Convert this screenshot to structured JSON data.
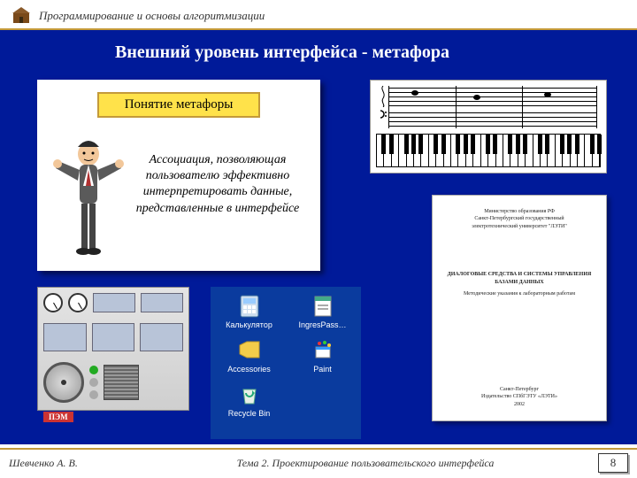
{
  "header": {
    "course": "Программирование и основы алгоритмизации"
  },
  "slide": {
    "title": "Внешний уровень интерфейса - метафора",
    "concept_label": "Понятие метафоры",
    "concept_definition": "Ассоциация, позволяющая пользователю эффективно интерпретировать данные, представленные в интерфейсе"
  },
  "desktop_icons": [
    {
      "name": "calculator-icon",
      "label": "Калькулятор"
    },
    {
      "name": "ingres-icon",
      "label": "IngresPass…"
    },
    {
      "name": "accessories-icon",
      "label": "Accessories"
    },
    {
      "name": "paint-icon",
      "label": "Paint"
    },
    {
      "name": "recycle-bin-icon",
      "label": "Recycle Bin"
    }
  ],
  "document_preview": {
    "line1": "Министерство образования РФ",
    "line2": "Санкт-Петербургский государственный",
    "line3": "электротехнический университет \"ЛЭТИ\"",
    "mid_title": "ДИАЛОГОВЫЕ СРЕДСТВА И СИСТЕМЫ УПРАВЛЕНИЯ БАЗАМИ ДАННЫХ",
    "mid_sub": "Методические указания к лабораторным работам",
    "pub_city": "Санкт-Петербург",
    "pub_house": "Издательство СПбГЭТУ «ЛЭТИ»",
    "pub_year": "2002"
  },
  "footer": {
    "author": "Шевченко А. В.",
    "topic": "Тема 2. Проектирование пользовательского интерфейса",
    "page": "8"
  }
}
